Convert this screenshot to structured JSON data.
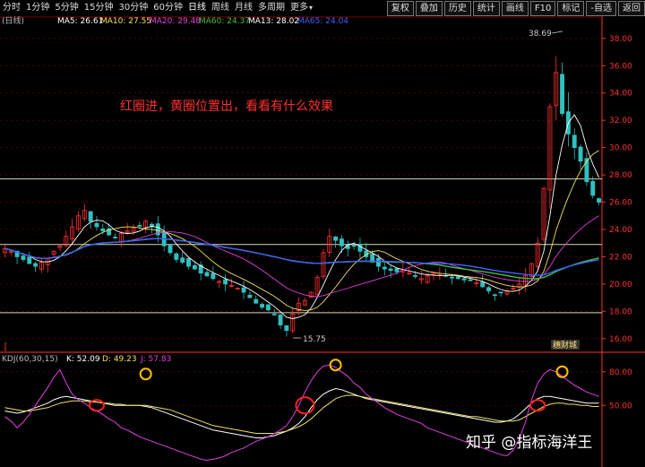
{
  "toolbar": {
    "tabs": [
      "分时",
      "1分钟",
      "5分钟",
      "15分钟",
      "30分钟",
      "60分钟",
      "日线",
      "周线",
      "月线",
      "多周期",
      "更多"
    ],
    "active_tab": "日线",
    "tools": [
      "复权",
      "叠加",
      "历史",
      "统计",
      "画线",
      "F10",
      "标记",
      "-自选",
      "返回"
    ]
  },
  "main_legend": {
    "period": "(日线)",
    "ma5": "MA5: 26.61",
    "ma10": "MA10: 27.55",
    "ma20": "MA20: 29.48",
    "ma60": "MA60: 24.37",
    "ma13": "MA13: 28.02",
    "ma65": "MA65: 24.04"
  },
  "annotation": "红圈进，黄圈位置出，看看有什么效果",
  "price_marks": {
    "high": "38.69",
    "low": "15.75"
  },
  "badge": "穗财城",
  "kdj_legend": {
    "name": "KDJ(60,30,15)",
    "k": "K: 52.09",
    "d": "D: 49.23",
    "j": "J: 57.83"
  },
  "watermark": "知乎 @指标海洋王",
  "colors": {
    "ma5": "#ffffff",
    "ma10": "#f0e060",
    "ma20": "#e040e0",
    "ma60": "#40c040",
    "ma13": "#ffffff",
    "ma65": "#4060ff",
    "up": "#ff3030",
    "down": "#30c0c0",
    "grid": "#800000",
    "axis": "#ff3030",
    "hline": "#d8d8b0",
    "red_circle": "#ff2020",
    "yellow_circle": "#ffc000"
  },
  "chart_data": {
    "type": "candlestick",
    "main_axis_ticks": [
      "16.00",
      "18.00",
      "20.00",
      "22.00",
      "24.00",
      "26.00",
      "28.00",
      "30.00",
      "32.00",
      "34.00",
      "36.00",
      "38.00"
    ],
    "main_ylim": [
      15.0,
      39.5
    ],
    "kdj_axis_ticks": [
      "50.00",
      "80.00"
    ],
    "kdj_ylim": [
      -5,
      95
    ],
    "horizontal_levels": [
      17.9,
      22.9,
      27.7
    ],
    "close": [
      22.6,
      22.4,
      22.0,
      21.8,
      21.5,
      21.3,
      21.6,
      21.9,
      22.4,
      22.8,
      23.5,
      24.2,
      25.0,
      25.4,
      24.6,
      24.2,
      23.9,
      23.6,
      23.4,
      23.7,
      23.9,
      24.1,
      24.3,
      24.6,
      24.2,
      23.6,
      22.8,
      22.3,
      21.8,
      21.6,
      21.3,
      21.1,
      20.8,
      20.6,
      20.4,
      20.2,
      20.0,
      19.9,
      19.7,
      19.4,
      19.0,
      18.6,
      18.3,
      18.1,
      17.8,
      17.0,
      16.6,
      17.8,
      18.6,
      18.8,
      19.4,
      20.5,
      22.3,
      23.5,
      23.2,
      22.8,
      22.6,
      22.8,
      22.4,
      22.0,
      21.6,
      21.3,
      21.1,
      21.0,
      20.9,
      21.0,
      20.8,
      20.6,
      20.4,
      20.6,
      20.8,
      20.7,
      20.6,
      20.5,
      20.4,
      20.3,
      20.3,
      20.1,
      19.8,
      19.5,
      19.2,
      19.4,
      19.5,
      19.7,
      20.0,
      20.6,
      21.5,
      23.0,
      27.0,
      33.0,
      35.5,
      32.5,
      31.0,
      30.0,
      29.0,
      27.5,
      26.5,
      26.0
    ],
    "ma_series": [
      {
        "name": "MA5",
        "values": []
      },
      {
        "name": "MA10",
        "values": []
      },
      {
        "name": "MA20",
        "values": []
      },
      {
        "name": "MA60",
        "values": []
      }
    ],
    "kdj": {
      "k": [
        45,
        44,
        43,
        44,
        46,
        48,
        50,
        52,
        55,
        57,
        58,
        57,
        56,
        55,
        54,
        53,
        52,
        51,
        50,
        50,
        50,
        50,
        50,
        49,
        48,
        46,
        44,
        42,
        40,
        38,
        36,
        34,
        32,
        30,
        28,
        27,
        26,
        25,
        24,
        23,
        22,
        21,
        21,
        22,
        23,
        25,
        27,
        30,
        34,
        40,
        48,
        55,
        60,
        63,
        65,
        64,
        62,
        60,
        58,
        56,
        55,
        54,
        53,
        52,
        51,
        50,
        49,
        48,
        47,
        46,
        45,
        44,
        43,
        42,
        41,
        40,
        39,
        38,
        37,
        36,
        35,
        35,
        36,
        38,
        42,
        47,
        52,
        56,
        58,
        58,
        57,
        56,
        55,
        54,
        53,
        52,
        52,
        52
      ],
      "d": [
        48,
        47,
        46,
        45,
        45,
        46,
        47,
        48,
        50,
        52,
        53,
        54,
        54,
        54,
        53,
        53,
        52,
        52,
        51,
        51,
        50,
        50,
        50,
        50,
        49,
        48,
        47,
        46,
        44,
        42,
        40,
        38,
        36,
        34,
        32,
        31,
        30,
        29,
        28,
        27,
        26,
        25,
        25,
        25,
        25,
        26,
        27,
        29,
        31,
        34,
        38,
        43,
        48,
        52,
        56,
        58,
        59,
        59,
        58,
        57,
        56,
        55,
        54,
        53,
        52,
        51,
        50,
        49,
        48,
        47,
        46,
        45,
        44,
        43,
        42,
        41,
        40,
        40,
        39,
        38,
        37,
        36,
        36,
        36,
        37,
        40,
        43,
        46,
        49,
        51,
        52,
        52,
        51,
        51,
        50,
        50,
        49,
        49
      ],
      "j": [
        40,
        36,
        30,
        35,
        42,
        50,
        58,
        66,
        75,
        82,
        70,
        60,
        55,
        52,
        48,
        45,
        42,
        38,
        35,
        30,
        28,
        25,
        22,
        20,
        18,
        16,
        14,
        12,
        10,
        8,
        6,
        4,
        2,
        1,
        2,
        3,
        5,
        8,
        10,
        12,
        15,
        18,
        20,
        22,
        25,
        28,
        32,
        40,
        50,
        62,
        72,
        80,
        85,
        86,
        84,
        80,
        76,
        70,
        66,
        60,
        56,
        52,
        48,
        45,
        42,
        40,
        38,
        36,
        34,
        30,
        28,
        26,
        24,
        22,
        20,
        18,
        16,
        14,
        12,
        10,
        8,
        6,
        5,
        10,
        20,
        35,
        55,
        70,
        78,
        82,
        80,
        76,
        72,
        68,
        65,
        62,
        60,
        58
      ]
    },
    "red_circles": [
      {
        "i": 15,
        "v": 50
      },
      {
        "i": 49,
        "v": 50
      },
      {
        "i": 87,
        "v": 50
      }
    ],
    "yellow_circles": [
      {
        "i": 23,
        "v": 78
      },
      {
        "i": 54,
        "v": 86
      },
      {
        "i": 91,
        "v": 80
      }
    ]
  }
}
